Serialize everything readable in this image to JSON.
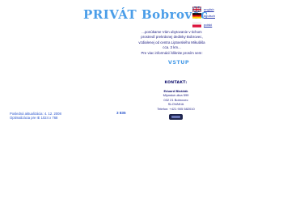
{
  "header": {
    "title": "PRIVÁT Bobrovec"
  },
  "languages": [
    {
      "label": "english",
      "flag": "gb-flag-icon"
    },
    {
      "label": "deutsch",
      "flag": "de-flag-icon"
    },
    {
      "label": "polski",
      "flag": "pl-flag-icon"
    }
  ],
  "intro": {
    "lines": [
      "...ponúkame Vám ubytovanie v tichom",
      "prostredí prekrásnej dedinky Bobrovec,",
      "vzdialenej od centra Liptovského Mikuláša",
      "cca. 3 km..."
    ],
    "more_info": "Pre viac informácií kliknite prosím sem:"
  },
  "enter_label": "VSTUP",
  "contact": {
    "heading": "KONTAKT:",
    "lines": [
      "Eduard Blaščák",
      "Mlynská ulica 599",
      "032 21 Bobrovec",
      "SLOVAKIA",
      "Telefon: +421 905 582010"
    ]
  },
  "footer": {
    "updated": "Posledná aktualizácia: 4. 12. 2008",
    "optimized": "Optimalizácia pre IE 1024 x 768"
  },
  "counter": "3 835",
  "colors": {
    "accent": "#4a9de8",
    "text": "#1a1a80",
    "link": "#2a55cc"
  }
}
